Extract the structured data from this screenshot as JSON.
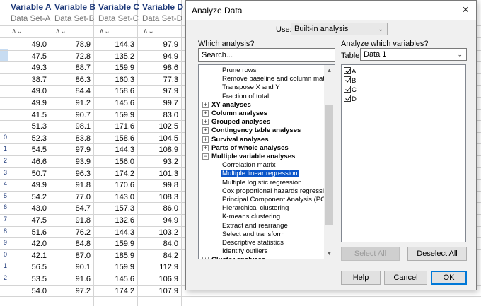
{
  "spreadsheet": {
    "columns": [
      {
        "name": "Variable A",
        "subtitle": "Data Set-A",
        "icon": "∧⌄"
      },
      {
        "name": "Variable B",
        "subtitle": "Data Set-B",
        "icon": "∧⌄"
      },
      {
        "name": "Variable C",
        "subtitle": "Data Set-C",
        "icon": "∧⌄"
      },
      {
        "name": "Variable D",
        "subtitle": "Data Set-D",
        "icon": "∧⌄"
      }
    ],
    "row_numbers": [
      "",
      "",
      "",
      "",
      "",
      "",
      "",
      "",
      "0",
      "1",
      "2",
      "3",
      "4",
      "5",
      "6",
      "7",
      "8",
      "9",
      "0",
      "1",
      "2"
    ],
    "rows": [
      [
        "49.0",
        "78.9",
        "144.3",
        "97.9"
      ],
      [
        "47.5",
        "72.8",
        "135.2",
        "94.9"
      ],
      [
        "49.3",
        "88.7",
        "159.9",
        "98.6"
      ],
      [
        "38.7",
        "86.3",
        "160.3",
        "77.3"
      ],
      [
        "49.0",
        "84.4",
        "158.6",
        "97.9"
      ],
      [
        "49.9",
        "91.2",
        "145.6",
        "99.7"
      ],
      [
        "41.5",
        "90.7",
        "159.9",
        "83.0"
      ],
      [
        "51.3",
        "98.1",
        "171.6",
        "102.5"
      ],
      [
        "52.3",
        "83.8",
        "158.6",
        "104.5"
      ],
      [
        "54.5",
        "97.9",
        "144.3",
        "108.9"
      ],
      [
        "46.6",
        "93.9",
        "156.0",
        "93.2"
      ],
      [
        "50.7",
        "96.3",
        "174.2",
        "101.3"
      ],
      [
        "49.9",
        "91.8",
        "170.6",
        "99.8"
      ],
      [
        "54.2",
        "77.0",
        "143.0",
        "108.3"
      ],
      [
        "43.0",
        "84.7",
        "157.3",
        "86.0"
      ],
      [
        "47.5",
        "91.8",
        "132.6",
        "94.9"
      ],
      [
        "51.6",
        "76.2",
        "144.3",
        "103.2"
      ],
      [
        "42.0",
        "84.8",
        "159.9",
        "84.0"
      ],
      [
        "42.1",
        "87.0",
        "185.9",
        "84.2"
      ],
      [
        "56.5",
        "90.1",
        "159.9",
        "112.9"
      ],
      [
        "53.5",
        "91.6",
        "145.6",
        "106.9"
      ],
      [
        "54.0",
        "97.2",
        "174.2",
        "107.9"
      ]
    ]
  },
  "dialog": {
    "title": "Analyze Data",
    "close_icon": "×",
    "use_label": "Use:",
    "use_value": "Built-in analysis",
    "which_analysis_label": "Which analysis?",
    "search_placeholder": "Search...",
    "analyze_vars_label": "Analyze which variables?",
    "table_label": "Table:",
    "table_value": "Data 1",
    "tree": [
      {
        "label": "Prune rows",
        "kind": "child"
      },
      {
        "label": "Remove baseline and column math",
        "kind": "child"
      },
      {
        "label": "Transpose X and Y",
        "kind": "child"
      },
      {
        "label": "Fraction of total",
        "kind": "child"
      },
      {
        "label": "XY analyses",
        "kind": "parent",
        "toggle": "+"
      },
      {
        "label": "Column analyses",
        "kind": "parent",
        "toggle": "+"
      },
      {
        "label": "Grouped analyses",
        "kind": "parent",
        "toggle": "+"
      },
      {
        "label": "Contingency table analyses",
        "kind": "parent",
        "toggle": "+"
      },
      {
        "label": "Survival analyses",
        "kind": "parent",
        "toggle": "+"
      },
      {
        "label": "Parts of whole analyses",
        "kind": "parent",
        "toggle": "+"
      },
      {
        "label": "Multiple variable analyses",
        "kind": "parent",
        "toggle": "−"
      },
      {
        "label": "Correlation matrix",
        "kind": "child"
      },
      {
        "label": "Multiple linear regression",
        "kind": "child",
        "selected": true
      },
      {
        "label": "Multiple logistic regression",
        "kind": "child"
      },
      {
        "label": "Cox proportional hazards regression",
        "kind": "child"
      },
      {
        "label": "Principal Component Analysis (PCA)",
        "kind": "child"
      },
      {
        "label": "Hierarchical clustering",
        "kind": "child"
      },
      {
        "label": "K-means clustering",
        "kind": "child"
      },
      {
        "label": "Extract and rearrange",
        "kind": "child"
      },
      {
        "label": "Select and transform",
        "kind": "child"
      },
      {
        "label": "Descriptive statistics",
        "kind": "child"
      },
      {
        "label": "Identify outliers",
        "kind": "child"
      },
      {
        "label": "Cluster analyses",
        "kind": "parent",
        "toggle": "+"
      }
    ],
    "variables": [
      {
        "label": "A",
        "checked": true
      },
      {
        "label": "B",
        "checked": true
      },
      {
        "label": "C",
        "checked": true
      },
      {
        "label": "D",
        "checked": true
      }
    ],
    "select_all_label": "Select All",
    "deselect_all_label": "Deselect All",
    "help_label": "Help",
    "cancel_label": "Cancel",
    "ok_label": "OK",
    "scroll_up_icon": "▲",
    "scroll_down_icon": "▼",
    "dropdown_icon": "⌄"
  },
  "colors": {
    "selection": "#0a55c9",
    "header_text": "#1f3a7a",
    "default_button_border": "#0078d7"
  }
}
